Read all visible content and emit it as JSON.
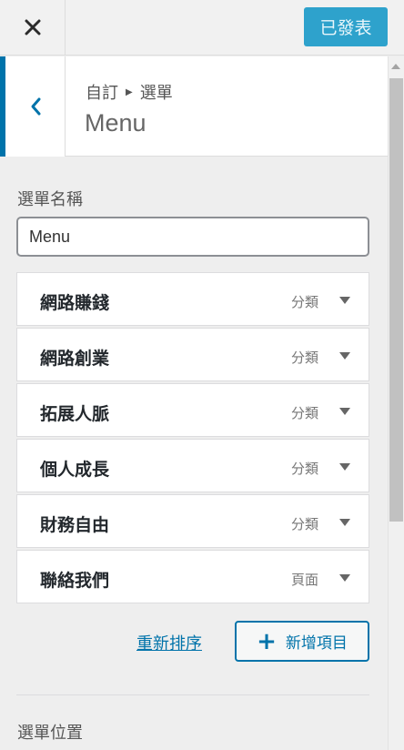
{
  "topbar": {
    "close_icon": "close-icon",
    "publish_label": "已發表"
  },
  "section": {
    "breadcrumb": {
      "parent": "自訂",
      "current": "選單"
    },
    "title": "Menu",
    "back_icon": "chevron-left-icon"
  },
  "menu_name": {
    "label": "選單名稱",
    "value": "Menu"
  },
  "menu_items": [
    {
      "title": "網路賺錢",
      "type": "分類"
    },
    {
      "title": "網路創業",
      "type": "分類"
    },
    {
      "title": "拓展人脈",
      "type": "分類"
    },
    {
      "title": "個人成長",
      "type": "分類"
    },
    {
      "title": "財務自由",
      "type": "分類"
    },
    {
      "title": "聯絡我們",
      "type": "頁面"
    }
  ],
  "actions": {
    "reorder_label": "重新排序",
    "add_label": "新增項目",
    "add_icon": "plus-icon"
  },
  "menu_location": {
    "label": "選單位置"
  },
  "colors": {
    "accent": "#0073aa",
    "publish": "#2ea2cc"
  }
}
